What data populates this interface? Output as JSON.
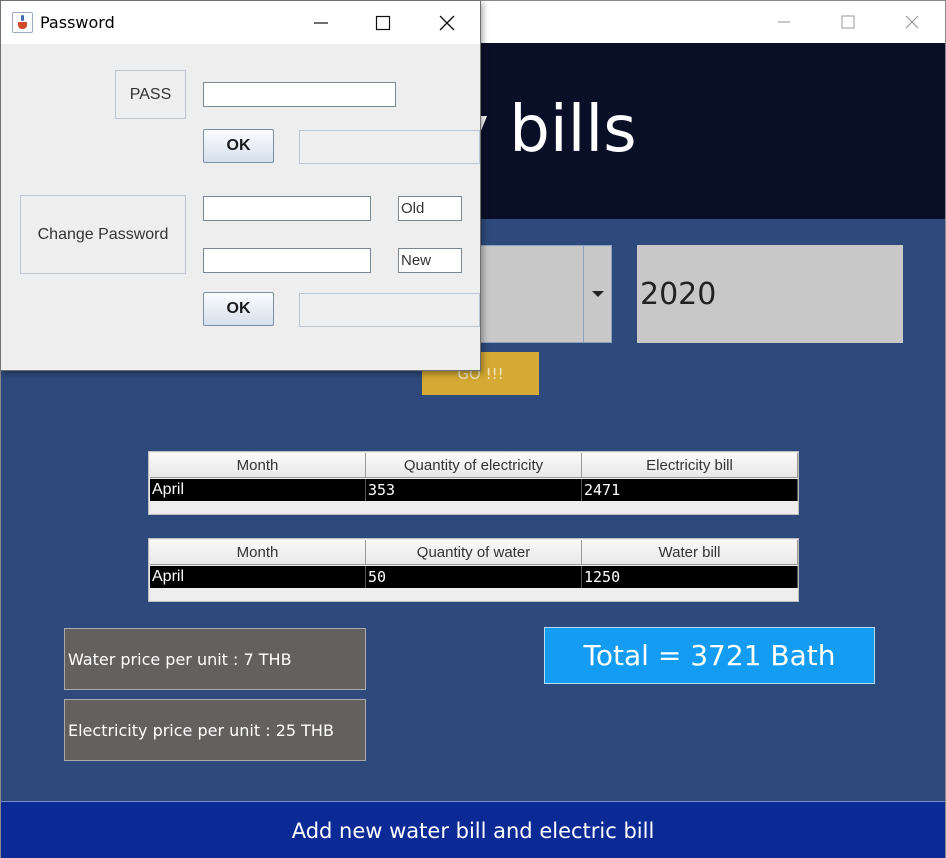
{
  "main_window": {
    "header_title": "y bills",
    "year": "2020",
    "go_label": "GO !!!",
    "electricity_table": {
      "columns": [
        "Month",
        "Quantity of electricity",
        "Electricity bill"
      ],
      "rows": [
        [
          "April",
          "353",
          "2471"
        ]
      ]
    },
    "water_table": {
      "columns": [
        "Month",
        "Quantity of water",
        "Water bill"
      ],
      "rows": [
        [
          "April",
          "50",
          "1250"
        ]
      ]
    },
    "water_price": "Water price per unit : 7 THB",
    "electricity_price": "Electricity price per unit : 25 THB",
    "total": "Total = 3721 Bath",
    "add_button": "Add new water bill and electric bill"
  },
  "password_dialog": {
    "title": "Password",
    "pass_label": "PASS",
    "pass_value": "",
    "ok_label": "OK",
    "change_label": "Change Password",
    "old_label": "Old",
    "new_label": "New",
    "ok2_label": "OK"
  },
  "colors": {
    "main_bg": "#2e4a7c",
    "header_bg": "#0a0f28",
    "go_button": "#d4a934",
    "total_bg": "#149cf2",
    "add_button_bg": "#0b2a95"
  }
}
